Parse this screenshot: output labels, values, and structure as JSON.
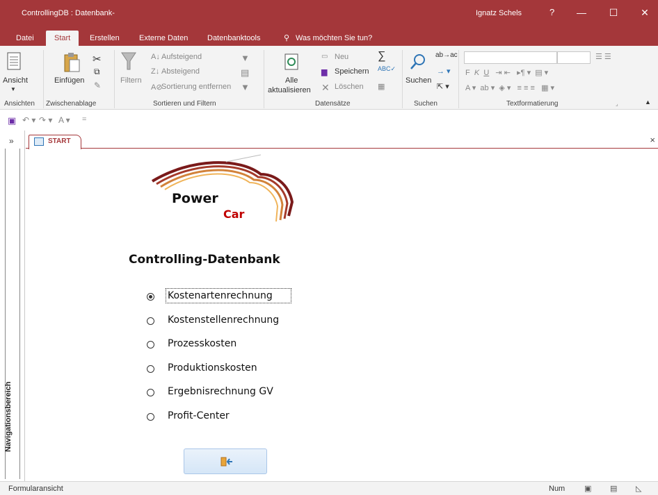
{
  "titlebar": {
    "app_title": "ControllingDB : Datenbank-",
    "user": "Ignatz Schels",
    "help": "?",
    "minimize": "—",
    "maximize": "☐",
    "close": "✕",
    "color": "#a4373a"
  },
  "tabs": [
    {
      "label": "Datei"
    },
    {
      "label": "Start"
    },
    {
      "label": "Erstellen"
    },
    {
      "label": "Externe Daten"
    },
    {
      "label": "Datenbanktools"
    },
    {
      "label": "Was möchten Sie tun?"
    }
  ],
  "ribbon": {
    "ansicht": "Ansicht",
    "einfuegen": "Einfügen",
    "filtern": "Filtern",
    "aufsteigend": "Aufsteigend",
    "absteigend": "Absteigend",
    "sortierung_entfernen": "Sortierung entfernen",
    "alle_aktualisieren_1": "Alle",
    "alle_aktualisieren_2": "aktualisieren",
    "neu": "Neu",
    "speichern": "Speichern",
    "loeschen": "Löschen",
    "suchen": "Suchen",
    "groups": {
      "ansichten": "Ansichten",
      "zwischenablage": "Zwischenablage",
      "sortieren_filtern": "Sortieren und Filtern",
      "datensaetze": "Datensätze",
      "suchen": "Suchen",
      "textformatierung": "Textformatierung"
    }
  },
  "nav": {
    "label": "Navigationsbereich",
    "expand": "»"
  },
  "document": {
    "tab_label": "START",
    "close": "×"
  },
  "form": {
    "logo_power": "Power",
    "logo_car": "Car",
    "title": "Controlling-Datenbank",
    "options": [
      {
        "label": "Kostenartenrechnung",
        "selected": true
      },
      {
        "label": "Kostenstellenrechnung",
        "selected": false
      },
      {
        "label": "Prozesskosten",
        "selected": false
      },
      {
        "label": "Produktionskosten",
        "selected": false
      },
      {
        "label": "Ergebnisrechnung GV",
        "selected": false
      },
      {
        "label": "Profit-Center",
        "selected": false
      }
    ]
  },
  "statusbar": {
    "view": "Formularansicht",
    "num": "Num"
  }
}
